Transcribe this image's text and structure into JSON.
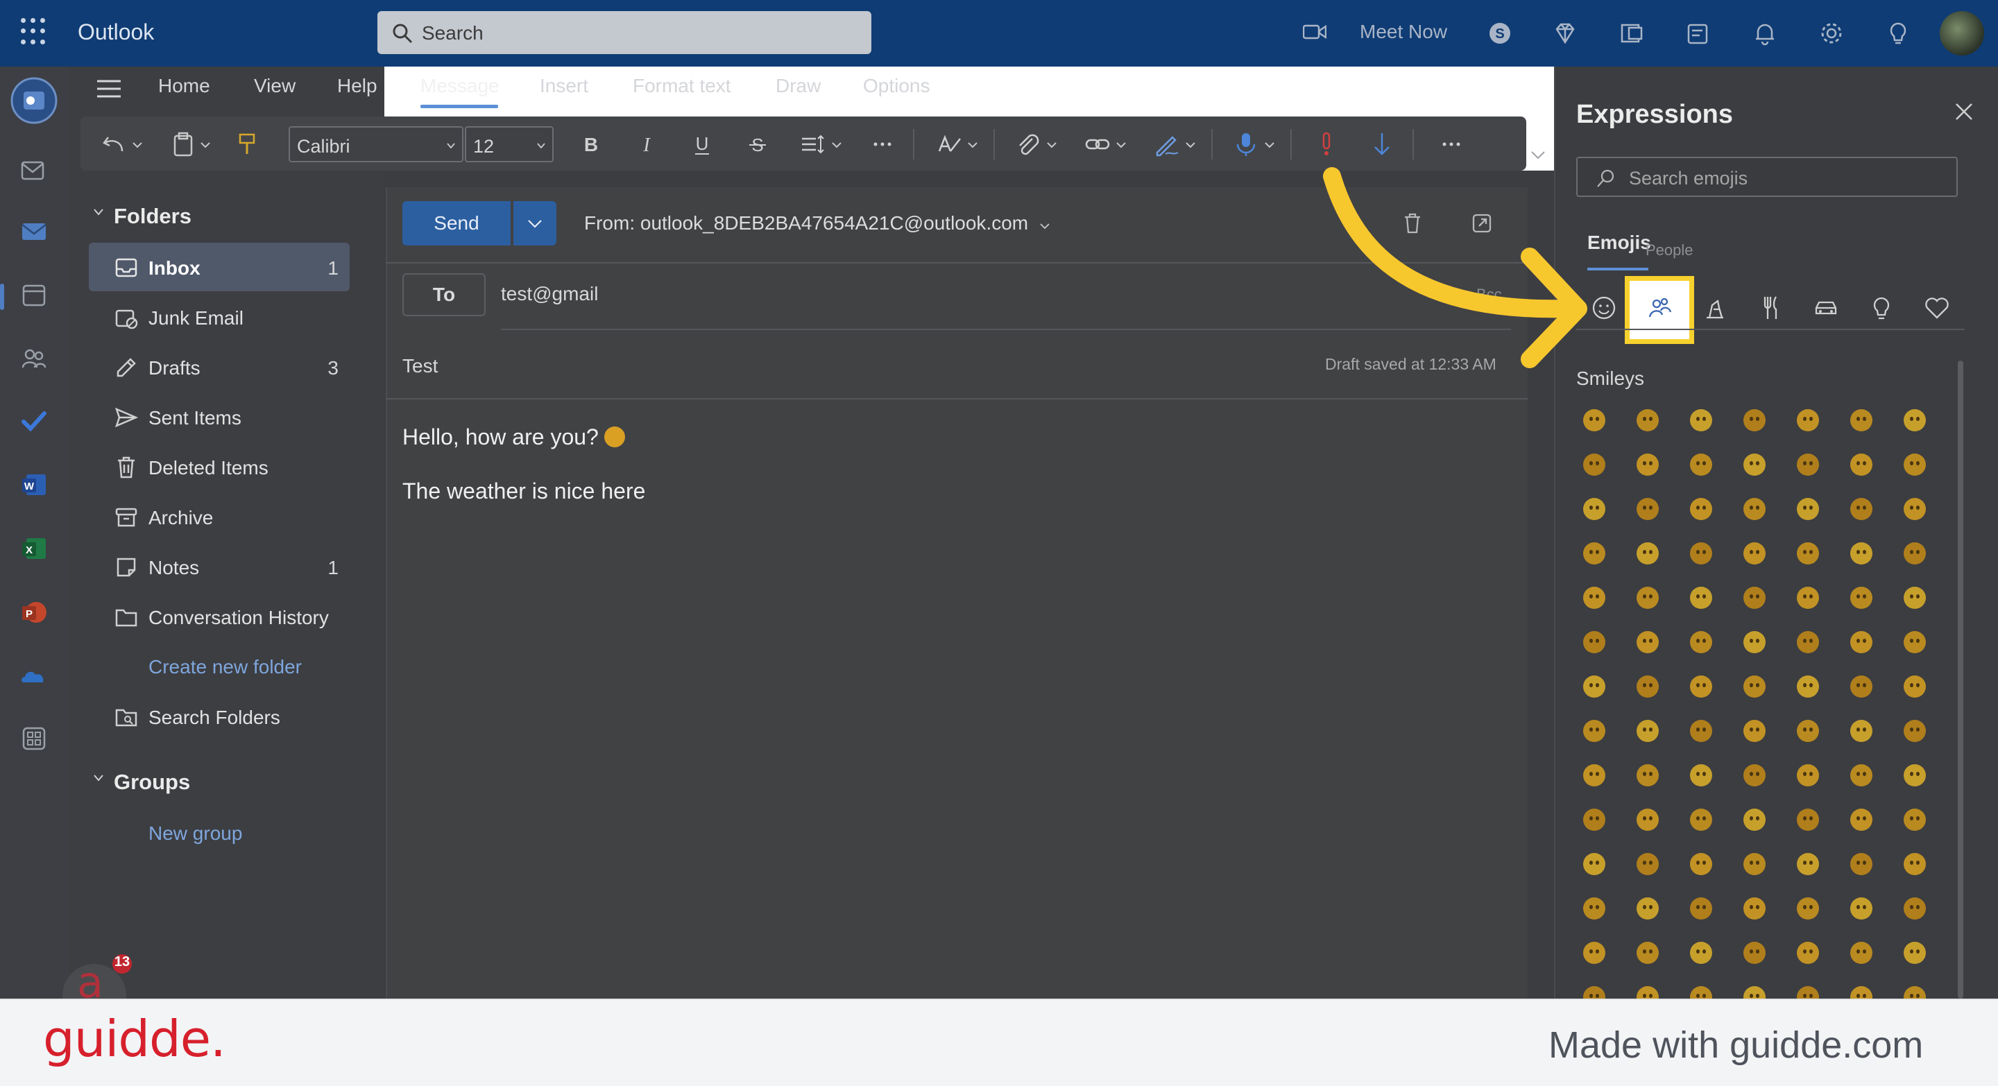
{
  "app": {
    "title": "Outlook"
  },
  "search": {
    "placeholder": "Search"
  },
  "header": {
    "meet_now": "Meet Now"
  },
  "ribbon": {
    "tabs": [
      {
        "label": "Home"
      },
      {
        "label": "View"
      },
      {
        "label": "Help"
      },
      {
        "label": "Message",
        "active": true
      },
      {
        "label": "Insert"
      },
      {
        "label": "Format text"
      },
      {
        "label": "Draw"
      },
      {
        "label": "Options"
      }
    ],
    "font_family": "Calibri",
    "font_size": "12"
  },
  "folders": {
    "title": "Folders",
    "items": [
      {
        "label": "Inbox",
        "count": "1",
        "icon": "inbox-icon",
        "selected": true
      },
      {
        "label": "Junk Email",
        "count": "",
        "icon": "junk-icon"
      },
      {
        "label": "Drafts",
        "count": "3",
        "icon": "drafts-icon"
      },
      {
        "label": "Sent Items",
        "count": "",
        "icon": "send-icon"
      },
      {
        "label": "Deleted Items",
        "count": "",
        "icon": "trash-icon"
      },
      {
        "label": "Archive",
        "count": "",
        "icon": "archive-icon"
      },
      {
        "label": "Notes",
        "count": "1",
        "icon": "notes-icon"
      },
      {
        "label": "Conversation History",
        "count": "",
        "icon": "folder-icon"
      }
    ],
    "create_new": "Create new folder",
    "search_folders": "Search Folders"
  },
  "groups": {
    "title": "Groups",
    "new_group": "New group"
  },
  "badge": {
    "count": "13"
  },
  "compose": {
    "send_label": "Send",
    "from": "From: outlook_8DEB2BA47654A21C@outlook.com",
    "to_label": "To",
    "to_value": "test@gmail",
    "bcc_label": "Bcc",
    "subject": "Test",
    "draft_status": "Draft saved at 12:33 AM",
    "body": [
      "Hello, how are you?",
      "The weather is nice here"
    ]
  },
  "expressions": {
    "title": "Expressions",
    "search_placeholder": "Search emojis",
    "tab": "Emojis",
    "tooltip": "People",
    "categories": [
      "smiley-icon",
      "people-icon",
      "nature-icon",
      "food-icon",
      "car-icon",
      "lightbulb-icon",
      "heart-icon"
    ],
    "selected_category": "people-icon",
    "section": "Smileys",
    "accent": "#f7d12e"
  },
  "footer": {
    "logo": "guidde.",
    "tagline": "Made with guidde.com",
    "logo_color": "#d6202c"
  }
}
